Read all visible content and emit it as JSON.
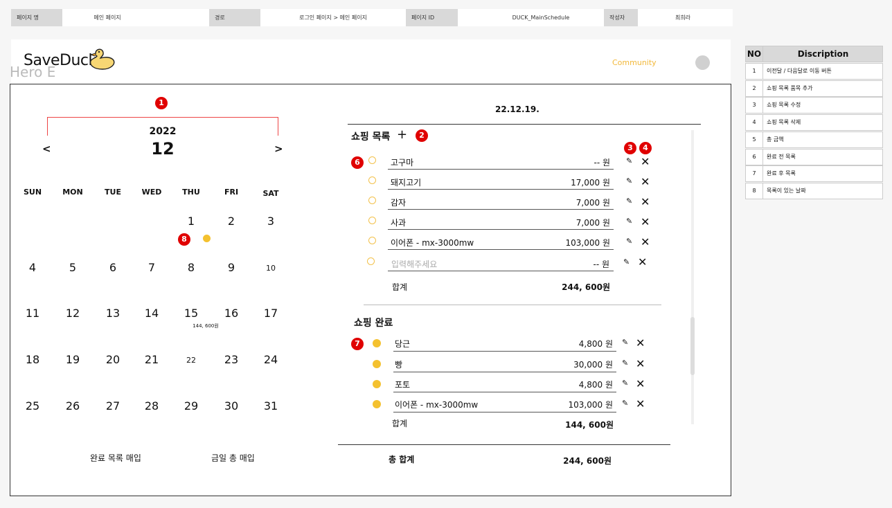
{
  "info_bar": {
    "page_name_label": "페이지 명",
    "page_name": "메인 페이지",
    "path_label": "경로",
    "path": "로그인 페이지 > 메인 페이지",
    "page_id_label": "페이지 ID",
    "page_id": "DUCK_MainSchedule",
    "author_label": "작성자",
    "author": "최희라"
  },
  "header": {
    "logo": "SaveDuck",
    "hero": "Hero E",
    "community": "Community"
  },
  "calendar": {
    "year": "2022",
    "month": "12",
    "prev": "<",
    "next": ">",
    "day_names": [
      "SUN",
      "MON",
      "TUE",
      "WED",
      "THU",
      "FRI",
      "SAT"
    ],
    "weeks": [
      [
        "",
        "",
        "",
        "",
        "1",
        "2",
        "3"
      ],
      [
        "4",
        "5",
        "6",
        "7",
        "8",
        "9",
        "10"
      ],
      [
        "11",
        "12",
        "13",
        "14",
        "15",
        "16",
        "17"
      ],
      [
        "18",
        "19",
        "20",
        "21",
        "22",
        "23",
        "24"
      ],
      [
        "25",
        "26",
        "27",
        "28",
        "29",
        "30",
        "31"
      ]
    ],
    "day15_note": "144, 600원",
    "footer_left": "완료 목록 매입",
    "footer_right": "금일 총 매입"
  },
  "badges": [
    "1",
    "2",
    "3",
    "4",
    "6",
    "7",
    "8"
  ],
  "date": "22.12.19.",
  "shopping": {
    "title": "쇼핑 목록",
    "add": "+",
    "items": [
      {
        "name": "고구마",
        "price": "-- 원"
      },
      {
        "name": "돼지고기",
        "price": "17,000 원"
      },
      {
        "name": "감자",
        "price": "7,000 원"
      },
      {
        "name": "사과",
        "price": "7,000 원"
      },
      {
        "name": "이어폰  - mx-3000mw",
        "price": "103,000 원"
      }
    ],
    "input_placeholder": "입력해주세요",
    "input_price": "-- 원",
    "total_label": "합계",
    "total": "244, 600원"
  },
  "done": {
    "title": "쇼핑 완료",
    "items": [
      {
        "name": "당근",
        "price": "4,800 원"
      },
      {
        "name": "빵",
        "price": "30,000 원"
      },
      {
        "name": "포토",
        "price": "4,800 원"
      },
      {
        "name": "이어폰  - mx-3000mw",
        "price": "103,000 원"
      }
    ],
    "total_label": "합계",
    "total": "144, 600원"
  },
  "grand": {
    "label": "총 합계",
    "total": "244, 600원"
  },
  "desc_table": {
    "head_no": "NO",
    "head_desc": "Discription",
    "rows": [
      {
        "no": "1",
        "desc": "이전달 / 다음달로 이동 버튼"
      },
      {
        "no": "2",
        "desc": "쇼핑 목록 품목 추가"
      },
      {
        "no": "3",
        "desc": "쇼핑 목록 수정"
      },
      {
        "no": "4",
        "desc": "쇼핑 목록 삭제"
      },
      {
        "no": "5",
        "desc": "총 금액"
      },
      {
        "no": "6",
        "desc": "완료 전 목록"
      },
      {
        "no": "7",
        "desc": "완료 후 목록"
      },
      {
        "no": "8",
        "desc": "목록이 있는 날짜"
      }
    ]
  },
  "colors": {
    "accent": "#f4c12f",
    "badge": "#e00000"
  }
}
